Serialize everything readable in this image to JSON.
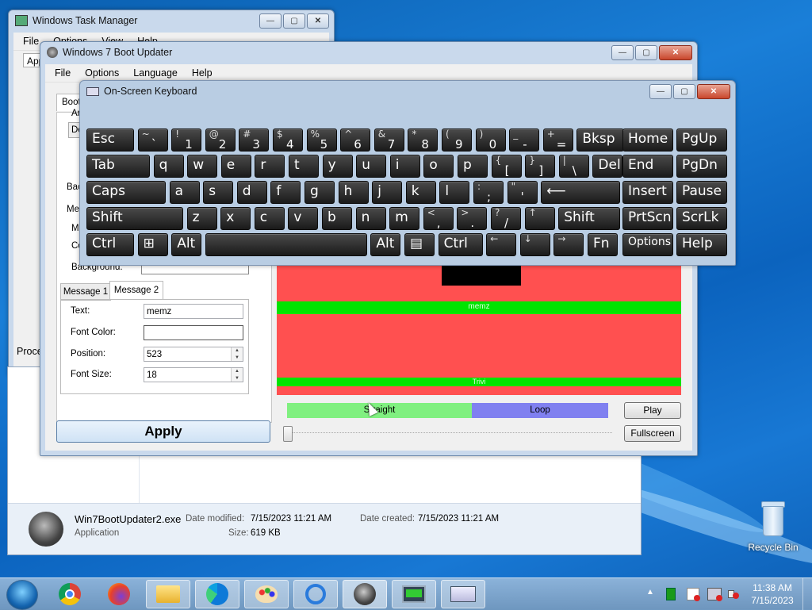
{
  "task_manager": {
    "title": "Windows Task Manager",
    "menus": [
      "File",
      "Options",
      "View",
      "Help"
    ],
    "tab_partial": "App",
    "status_partial": "Proce"
  },
  "explorer": {
    "file_name": "Win7BootUpdater2.exe",
    "file_type": "Application",
    "date_modified_label": "Date modified:",
    "date_modified": "7/15/2023 11:21 AM",
    "date_created_label": "Date created:",
    "date_created": "7/15/2023 11:21 AM",
    "size_label": "Size:",
    "size": "619 KB"
  },
  "boot_updater": {
    "title": "Windows 7 Boot Updater",
    "menus": [
      "File",
      "Options",
      "Language",
      "Help"
    ],
    "left_panel": {
      "tab_partial": "Boot",
      "frag_an": "An",
      "frag_de": "De",
      "frag_bac": "Bac",
      "frag_met": "Met",
      "frag_me": "Me",
      "frag_co": "Co",
      "background_label": "Background:",
      "background_color": "#00e400"
    },
    "msg_tabs": [
      "Message 1",
      "Message 2"
    ],
    "msg_form": {
      "text_label": "Text:",
      "text_value": "memz",
      "font_color_label": "Font Color:",
      "position_label": "Position:",
      "position_value": "523",
      "font_size_label": "Font Size:",
      "font_size_value": "18"
    },
    "apply_label": "Apply",
    "preview": {
      "bg": "#ff5050",
      "message_text": "memz",
      "message2_text": "Trivi"
    },
    "anim": {
      "straight_label": "Straight",
      "loop_label": "Loop",
      "play_label": "Play",
      "fullscreen_label": "Fullscreen"
    }
  },
  "osk": {
    "title": "On-Screen Keyboard",
    "rows": [
      [
        {
          "m": "Esc"
        },
        {
          "t": "~",
          "b": "`"
        },
        {
          "t": "!",
          "b": "1"
        },
        {
          "t": "@",
          "b": "2"
        },
        {
          "t": "#",
          "b": "3"
        },
        {
          "t": "$",
          "b": "4"
        },
        {
          "t": "%",
          "b": "5"
        },
        {
          "t": "^",
          "b": "6"
        },
        {
          "t": "&",
          "b": "7"
        },
        {
          "t": "*",
          "b": "8"
        },
        {
          "t": "(",
          "b": "9"
        },
        {
          "t": ")",
          "b": "0"
        },
        {
          "t": "_",
          "b": "-"
        },
        {
          "t": "+",
          "b": "="
        },
        {
          "m": "Bksp"
        },
        {
          "m": "Home"
        },
        {
          "m": "PgUp"
        }
      ],
      [
        {
          "m": "Tab"
        },
        {
          "m": "q"
        },
        {
          "m": "w"
        },
        {
          "m": "e"
        },
        {
          "m": "r"
        },
        {
          "m": "t"
        },
        {
          "m": "y"
        },
        {
          "m": "u"
        },
        {
          "m": "i"
        },
        {
          "m": "o"
        },
        {
          "m": "p"
        },
        {
          "t": "{",
          "b": "["
        },
        {
          "t": "}",
          "b": "]"
        },
        {
          "t": "|",
          "b": "\\"
        },
        {
          "m": "Del"
        },
        {
          "m": "End"
        },
        {
          "m": "PgDn"
        }
      ],
      [
        {
          "m": "Caps"
        },
        {
          "m": "a"
        },
        {
          "m": "s"
        },
        {
          "m": "d"
        },
        {
          "m": "f"
        },
        {
          "m": "g"
        },
        {
          "m": "h"
        },
        {
          "m": "j"
        },
        {
          "m": "k"
        },
        {
          "m": "l"
        },
        {
          "t": ":",
          "b": ";"
        },
        {
          "t": "\"",
          "b": "'"
        },
        {
          "m": "⟵"
        },
        {
          "m": "Insert"
        },
        {
          "m": "Pause"
        }
      ],
      [
        {
          "m": "Shift"
        },
        {
          "m": "z"
        },
        {
          "m": "x"
        },
        {
          "m": "c"
        },
        {
          "m": "v"
        },
        {
          "m": "b"
        },
        {
          "m": "n"
        },
        {
          "m": "m"
        },
        {
          "t": "<",
          "b": ","
        },
        {
          "t": ">",
          "b": "."
        },
        {
          "t": "?",
          "b": "/"
        },
        {
          "t": "↑",
          "b": ""
        },
        {
          "m": "Shift"
        },
        {
          "m": "PrtScn"
        },
        {
          "m": "ScrLk"
        }
      ],
      [
        {
          "m": "Ctrl"
        },
        {
          "m": "⊞"
        },
        {
          "m": "Alt"
        },
        {
          "m": ""
        },
        {
          "m": "Alt"
        },
        {
          "m": "▤"
        },
        {
          "m": "Ctrl"
        },
        {
          "t": "←",
          "b": ""
        },
        {
          "t": "↓",
          "b": ""
        },
        {
          "t": "→",
          "b": ""
        },
        {
          "m": "Fn"
        },
        {
          "m": "Options"
        },
        {
          "m": "Help"
        }
      ]
    ]
  },
  "desktop": {
    "recycle_bin_label": "Recycle Bin"
  },
  "taskbar": {
    "items": [
      "start-orb-icon",
      "chrome-icon",
      "firefox-icon",
      "file-explorer-icon",
      "edge-icon",
      "paint-icon",
      "chrome-alt-icon",
      "boot-updater-icon",
      "task-manager-icon",
      "osk-icon"
    ],
    "time": "11:38 AM",
    "date": "7/15/2023"
  }
}
